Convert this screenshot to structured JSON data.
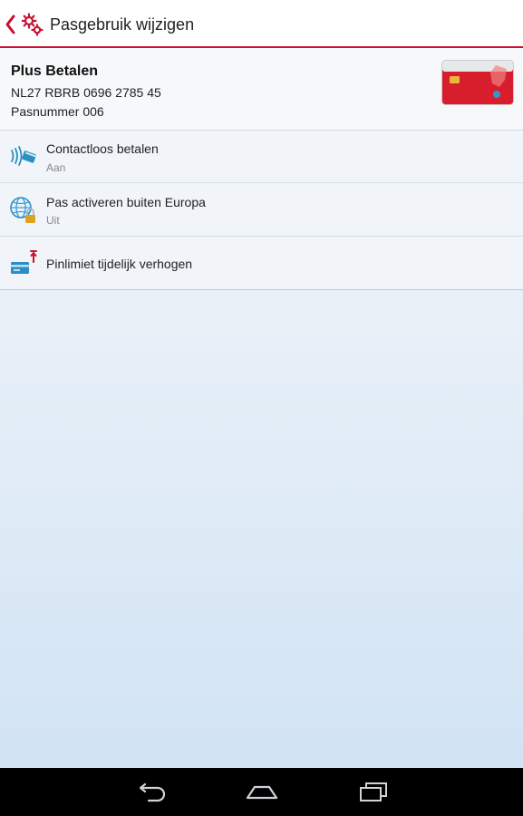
{
  "header": {
    "title": "Pasgebruik wijzigen",
    "back_icon": "chevron-left-icon",
    "settings_icon": "gears-icon",
    "accent_color": "#c8102e"
  },
  "card": {
    "name": "Plus Betalen",
    "iban": "NL27 RBRB 0696 2785 45",
    "number": "Pasnummer 006",
    "image": "debit-card-image"
  },
  "settings": [
    {
      "title": "Contactloos betalen",
      "status": "Aan",
      "icon": "contactless-icon"
    },
    {
      "title": "Pas activeren buiten Europa",
      "status": "Uit",
      "icon": "globe-lock-icon"
    },
    {
      "title": "Pinlimiet tijdelijk verhogen",
      "status": "",
      "icon": "limit-raise-icon"
    }
  ],
  "navbar": {
    "back": "nav-back-icon",
    "home": "nav-home-icon",
    "recent": "nav-recent-icon"
  }
}
